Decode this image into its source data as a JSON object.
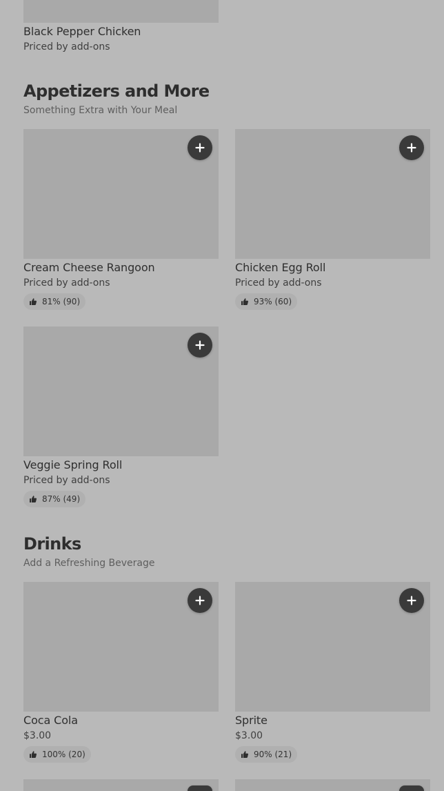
{
  "top_item": {
    "name": "Black Pepper Chicken",
    "price": "Priced by add-ons"
  },
  "sections": [
    {
      "title": "Appetizers and More",
      "subtitle": "Something Extra with Your Meal",
      "items": [
        {
          "name": "Cream Cheese Rangoon",
          "price": "Priced by add-ons",
          "rating": "81% (90)"
        },
        {
          "name": "Chicken Egg Roll",
          "price": "Priced by add-ons",
          "rating": "93% (60)"
        },
        {
          "name": "Veggie Spring Roll",
          "price": "Priced by add-ons",
          "rating": "87% (49)"
        }
      ]
    },
    {
      "title": "Drinks",
      "subtitle": "Add a Refreshing Beverage",
      "items": [
        {
          "name": "Coca Cola",
          "price": "$3.00",
          "rating": "100% (20)"
        },
        {
          "name": "Sprite",
          "price": "$3.00",
          "rating": "90% (21)"
        }
      ]
    }
  ],
  "icons": {
    "add": "plus-icon",
    "rating": "thumbs-up-icon"
  },
  "colors": {
    "background": "#b9b9b9",
    "image_placeholder": "#a9a9a9",
    "add_button": "#3a3a3a",
    "rating_pill": "#b0b0b0"
  }
}
